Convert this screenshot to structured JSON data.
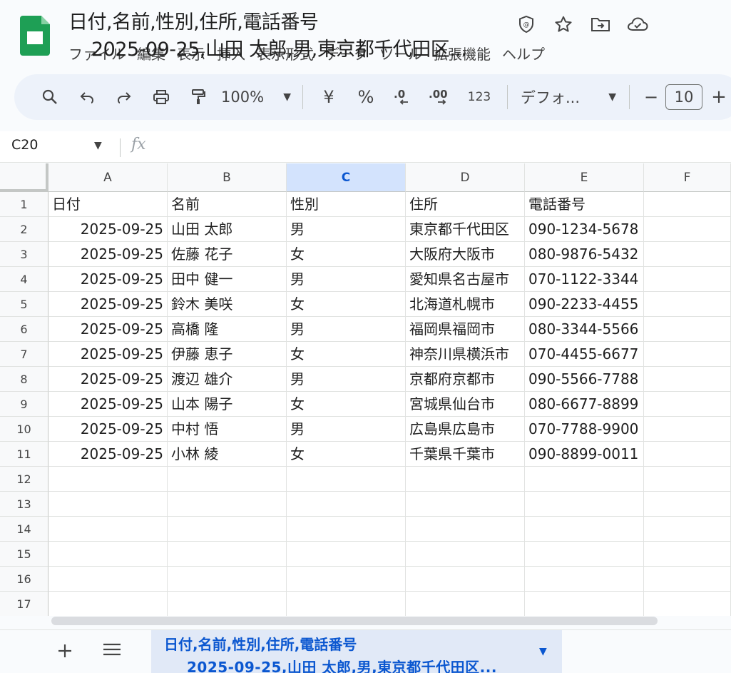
{
  "document": {
    "title_line1": "日付,名前,性別,住所,電話番号",
    "title_line2": "2025-09-25,山田 太郎,男,東京都千代田区..."
  },
  "menu": [
    "ファイル",
    "編集",
    "表示",
    "挿入",
    "表示形式",
    "データ",
    "ツール",
    "拡張機能",
    "ヘルプ"
  ],
  "top_icons": [
    "shield-icon",
    "star-icon",
    "move-folder-icon",
    "cloud-icon"
  ],
  "toolbar": {
    "zoom": "100%",
    "currency": "¥",
    "percent": "%",
    "decrease_decimal": ".0",
    "increase_decimal": ".00",
    "number_format": "123",
    "font": "デフォ...",
    "font_size": "10",
    "minus": "−",
    "plus": "+"
  },
  "formula_bar": {
    "name_box": "C20",
    "fx": "fx",
    "value": ""
  },
  "grid": {
    "selected_column": "C",
    "columns": [
      "A",
      "B",
      "C",
      "D",
      "E",
      "F"
    ],
    "row_numbers": [
      "1",
      "2",
      "3",
      "4",
      "5",
      "6",
      "7",
      "8",
      "9",
      "10",
      "11",
      "12",
      "13",
      "14",
      "15",
      "16",
      "17"
    ],
    "header_row": [
      "日付",
      "名前",
      "性別",
      "住所",
      "電話番号"
    ],
    "rows": [
      [
        "2025-09-25",
        "山田 太郎",
        "男",
        "東京都千代田区",
        "090-1234-5678"
      ],
      [
        "2025-09-25",
        "佐藤 花子",
        "女",
        "大阪府大阪市",
        "080-9876-5432"
      ],
      [
        "2025-09-25",
        "田中 健一",
        "男",
        "愛知県名古屋市",
        "070-1122-3344"
      ],
      [
        "2025-09-25",
        "鈴木 美咲",
        "女",
        "北海道札幌市",
        "090-2233-4455"
      ],
      [
        "2025-09-25",
        "高橋 隆",
        "男",
        "福岡県福岡市",
        "080-3344-5566"
      ],
      [
        "2025-09-25",
        "伊藤 恵子",
        "女",
        "神奈川県横浜市",
        "070-4455-6677"
      ],
      [
        "2025-09-25",
        "渡辺 雄介",
        "男",
        "京都府京都市",
        "090-5566-7788"
      ],
      [
        "2025-09-25",
        "山本 陽子",
        "女",
        "宮城県仙台市",
        "080-6677-8899"
      ],
      [
        "2025-09-25",
        "中村 悟",
        "男",
        "広島県広島市",
        "070-7788-9900"
      ],
      [
        "2025-09-25",
        "小林 綾",
        "女",
        "千葉県千葉市",
        "090-8899-0011"
      ]
    ]
  },
  "sheet_tab": {
    "line1": "日付,名前,性別,住所,電話番号",
    "line2": "2025-09-25,山田 太郎,男,東京都千代田区..."
  },
  "colors": {
    "accent": "#0b57d0",
    "selected_header": "#d3e3fd",
    "logo": "#1e9f55"
  }
}
